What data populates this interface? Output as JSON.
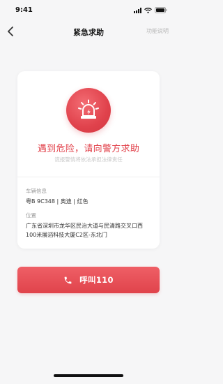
{
  "status_bar": {
    "time": "9:41"
  },
  "nav": {
    "title": "紧急求助",
    "help": "功能说明",
    "back_icon": "chevron-left-icon"
  },
  "card": {
    "headline": "遇到危险，请向警方求助",
    "subline": "谎报警情将依法承担法律责任",
    "vehicle_label": "车辆信息",
    "vehicle_value": "粤B 9C348 | 奥迪 | 红色",
    "location_label": "位置",
    "location_value": "广东省深圳市龙华区民治大道与民清路交叉口西100米展滔科技大厦C2区-东北门"
  },
  "call_button": {
    "label": "呼叫110",
    "icon": "phone-icon"
  },
  "colors": {
    "accent": "#e2434c",
    "background": "#f6f6f7"
  }
}
